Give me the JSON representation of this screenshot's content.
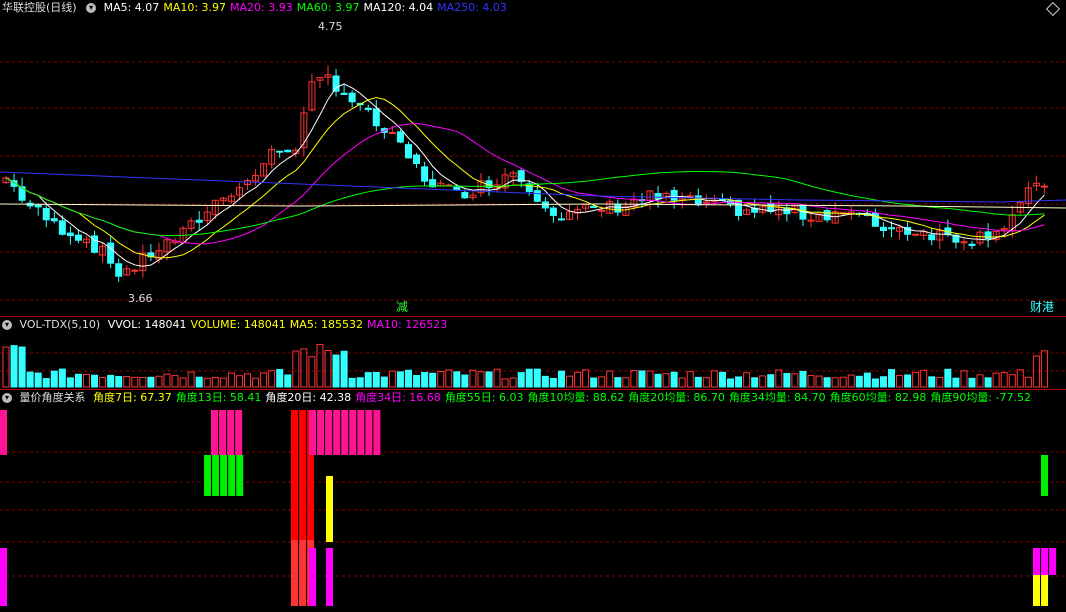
{
  "colors": {
    "up": "#ff3333",
    "down": "#33ffff",
    "ma5": "#ffffff",
    "ma10": "#ffff00",
    "ma20": "#ff00ff",
    "ma60": "#00ff00",
    "ma120": "#ffffff",
    "ma250": "#3333ff",
    "grid": "#8b0000"
  },
  "price_panel": {
    "title": "华联控股(日线)",
    "indicators": [
      {
        "label": "MA5: 4.07",
        "color": "#ffffff"
      },
      {
        "label": "MA10: 3.97",
        "color": "#ffff00"
      },
      {
        "label": "MA20: 3.93",
        "color": "#ff00ff"
      },
      {
        "label": "MA60: 3.97",
        "color": "#00ff00"
      },
      {
        "label": "MA120: 4.04",
        "color": "#ffffff"
      },
      {
        "label": "MA250: 4.03",
        "color": "#3333ff"
      }
    ],
    "high_label": "4.75",
    "low_label": "3.66",
    "marker_jian": "减",
    "marker_caigang": "财港"
  },
  "volume_panel": {
    "title": "VOL-TDX(5,10)",
    "indicators": [
      {
        "label": "VVOL: 148041",
        "color": "#ffffff"
      },
      {
        "label": "VOLUME: 148041",
        "color": "#ffff00"
      },
      {
        "label": "MA5: 185532",
        "color": "#ffff00"
      },
      {
        "label": "MA10: 126523",
        "color": "#ff00ff"
      }
    ]
  },
  "angle_panel": {
    "title": "量价角度关系",
    "indicators": [
      {
        "label": "角度7日: 67.37",
        "color": "#ffff00"
      },
      {
        "label": "角度13日: 58.41",
        "color": "#00ff00"
      },
      {
        "label": "角度20日: 42.38",
        "color": "#ffffff"
      },
      {
        "label": "角度34日: 16.68",
        "color": "#ff00ff"
      },
      {
        "label": "角度55日: 6.03",
        "color": "#00ff00"
      },
      {
        "label": "角度10均量: 88.62",
        "color": "#00ff00"
      },
      {
        "label": "角度20均量: 86.70",
        "color": "#00ff00"
      },
      {
        "label": "角度34均量: 84.70",
        "color": "#00ff00"
      },
      {
        "label": "角度60均量: 82.98",
        "color": "#00ff00"
      },
      {
        "label": "角度90均量: -77.52",
        "color": "#00ff00"
      }
    ]
  }
}
